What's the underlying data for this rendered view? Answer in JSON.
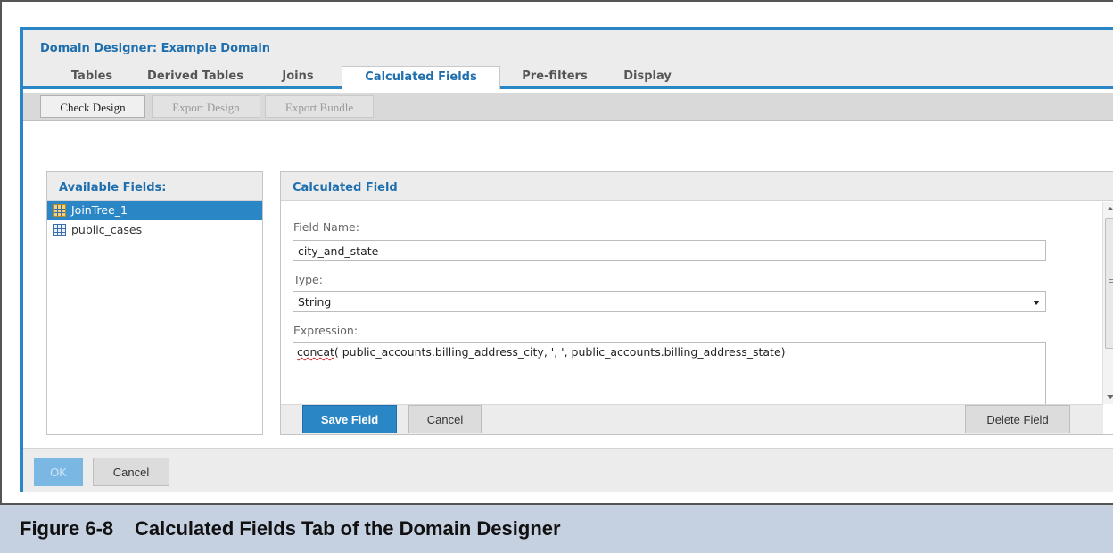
{
  "dialog": {
    "title": "Domain Designer: Example Domain",
    "accent_color": "#2a86c5",
    "tabs": [
      {
        "label": "Tables",
        "active": false
      },
      {
        "label": "Derived Tables",
        "active": false
      },
      {
        "label": "Joins",
        "active": false
      },
      {
        "label": "Calculated Fields",
        "active": true
      },
      {
        "label": "Pre-filters",
        "active": false
      },
      {
        "label": "Display",
        "active": false
      }
    ],
    "toolbar": {
      "check_design": "Check Design",
      "export_design": "Export Design",
      "export_bundle": "Export Bundle"
    }
  },
  "available_fields": {
    "header": "Available Fields:",
    "items": [
      {
        "label": "JoinTree_1",
        "icon": "join-tree-icon",
        "selected": true
      },
      {
        "label": "public_cases",
        "icon": "table-icon",
        "selected": false
      }
    ]
  },
  "calculated_field": {
    "header": "Calculated Field",
    "field_name_label": "Field Name:",
    "field_name_value": "city_and_state",
    "type_label": "Type:",
    "type_value": "String",
    "expression_label": "Expression:",
    "expression_func": "concat",
    "expression_rest": "( public_accounts.billing_address_city, ', ', public_accounts.billing_address_state)",
    "save_button": "Save Field",
    "cancel_button": "Cancel",
    "delete_button": "Delete Field"
  },
  "footer": {
    "ok_button": "OK",
    "cancel_button": "Cancel"
  },
  "caption": {
    "number": "Figure 6-8",
    "text": "Calculated Fields Tab of the Domain Designer"
  }
}
